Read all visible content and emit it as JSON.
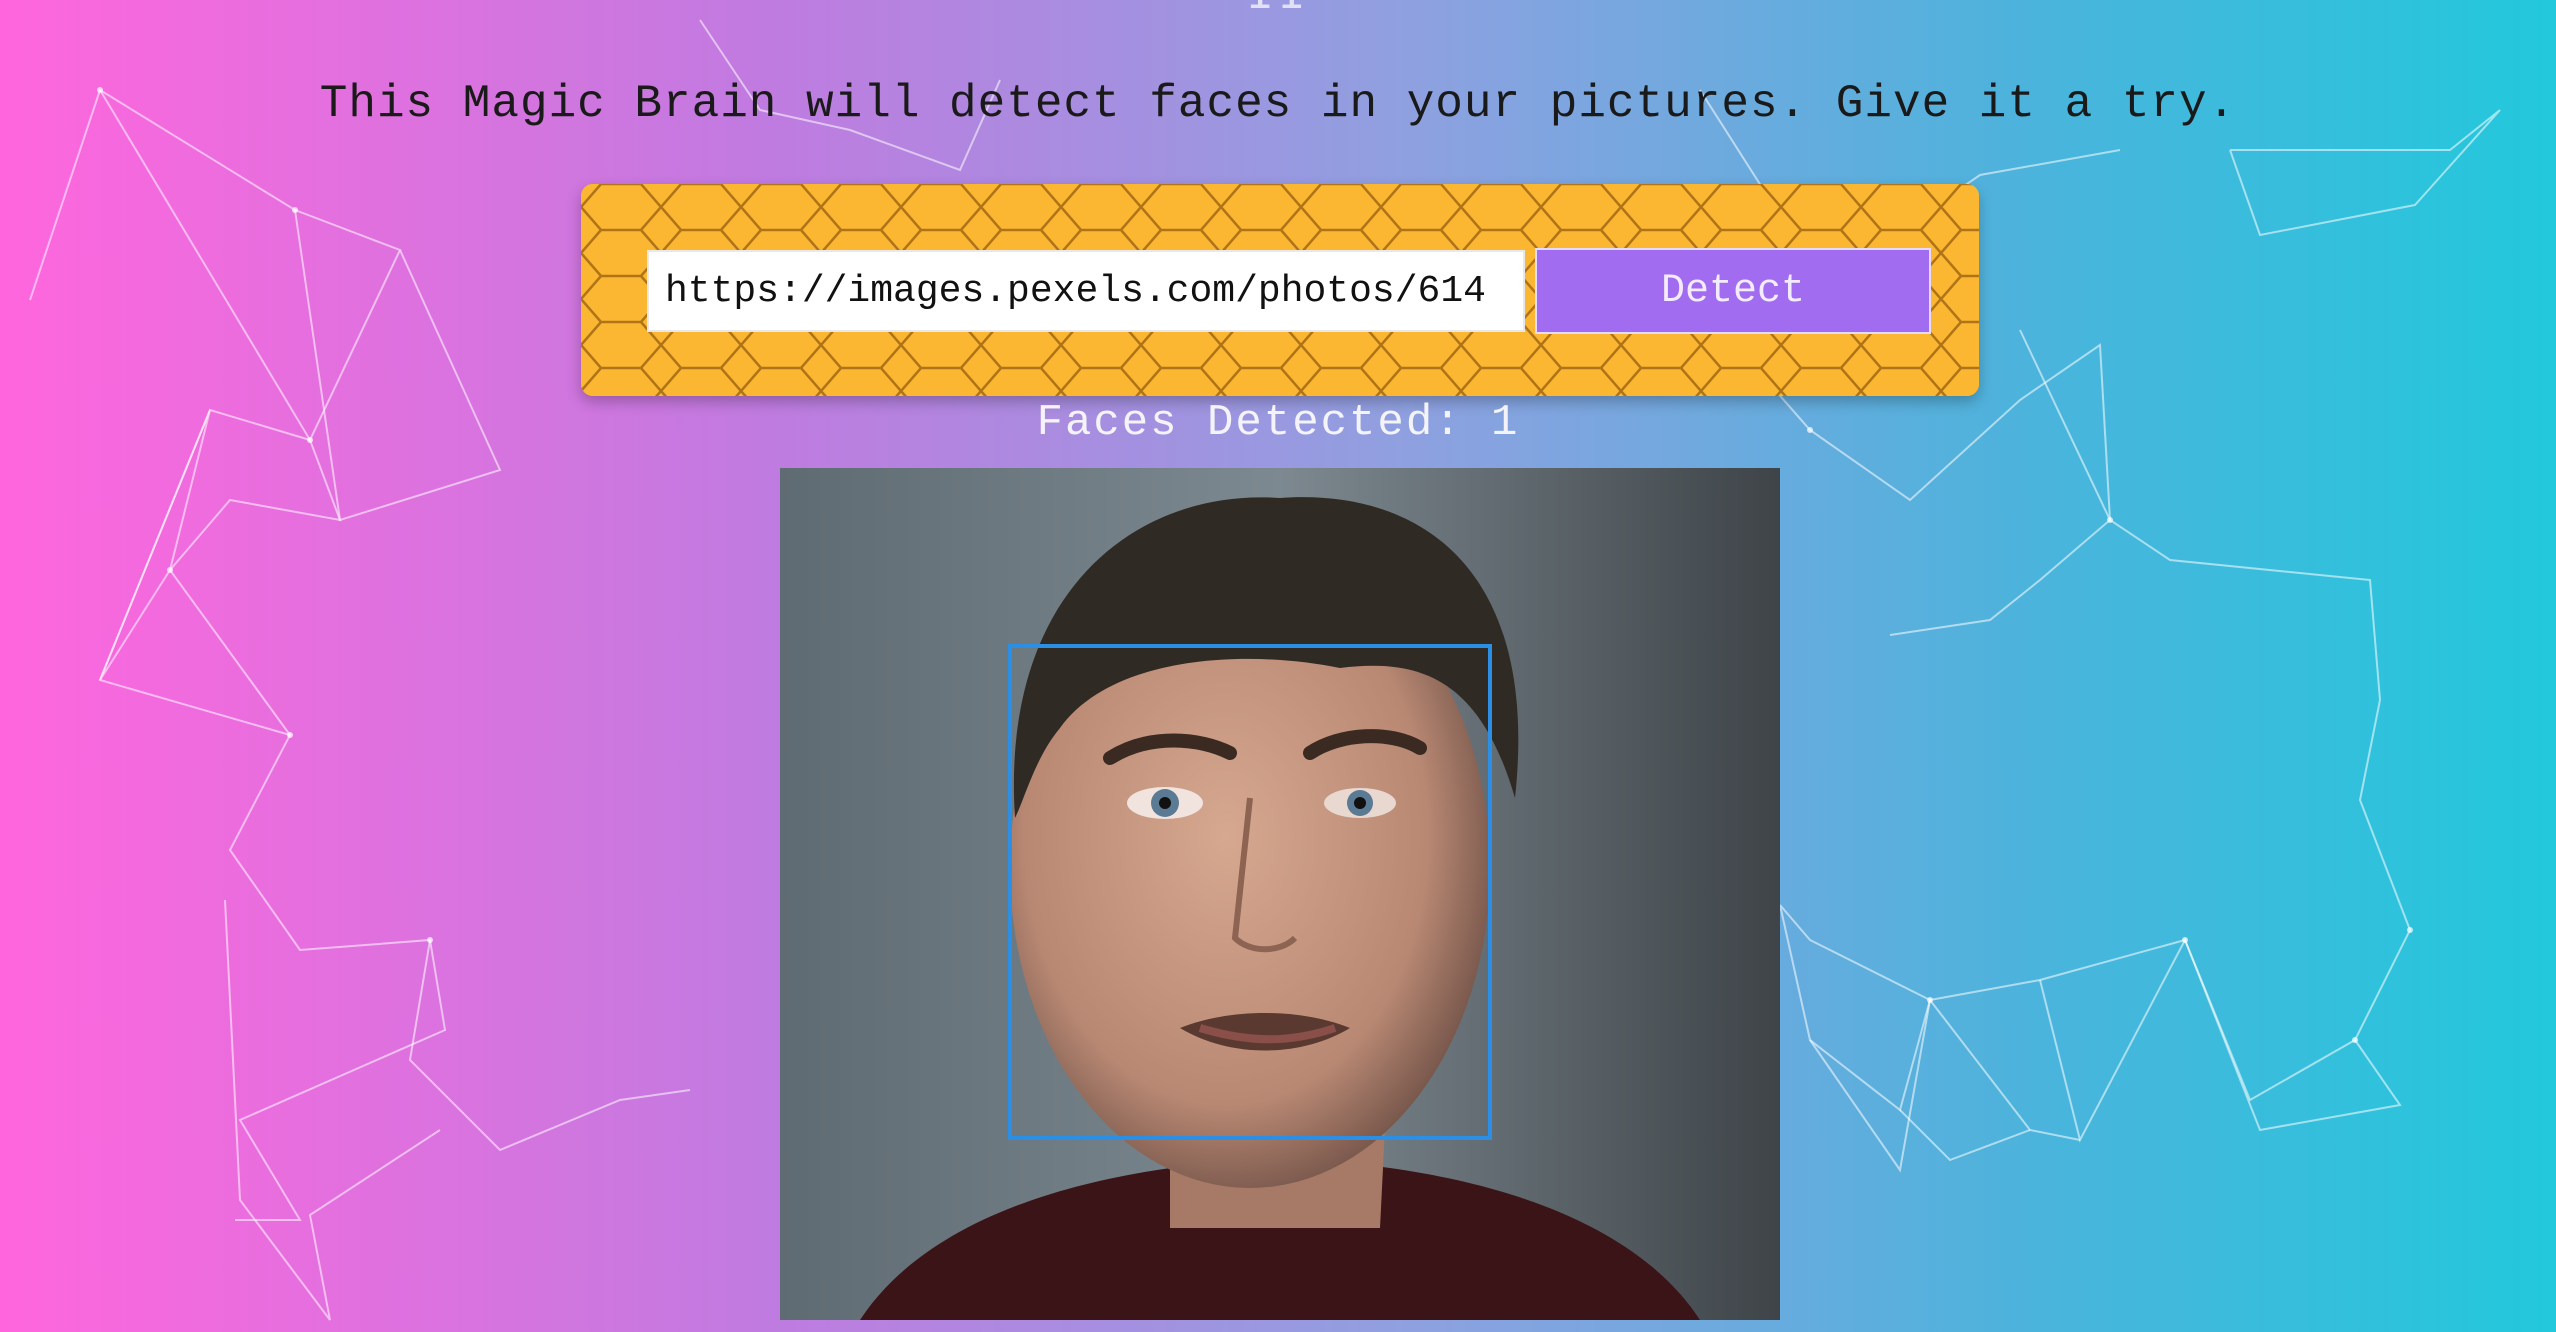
{
  "header": {
    "title_partial": "II",
    "tagline": "This Magic Brain will detect faces in your pictures. Give it a try."
  },
  "form": {
    "url_value": "https://images.pexels.com/photos/614",
    "detect_label": "Detect"
  },
  "result": {
    "faces_detected_text": "Faces Detected: 1"
  },
  "colors": {
    "panel": "#fbb731",
    "button": "#a26cf0",
    "face_box": "#2b8fe6"
  }
}
